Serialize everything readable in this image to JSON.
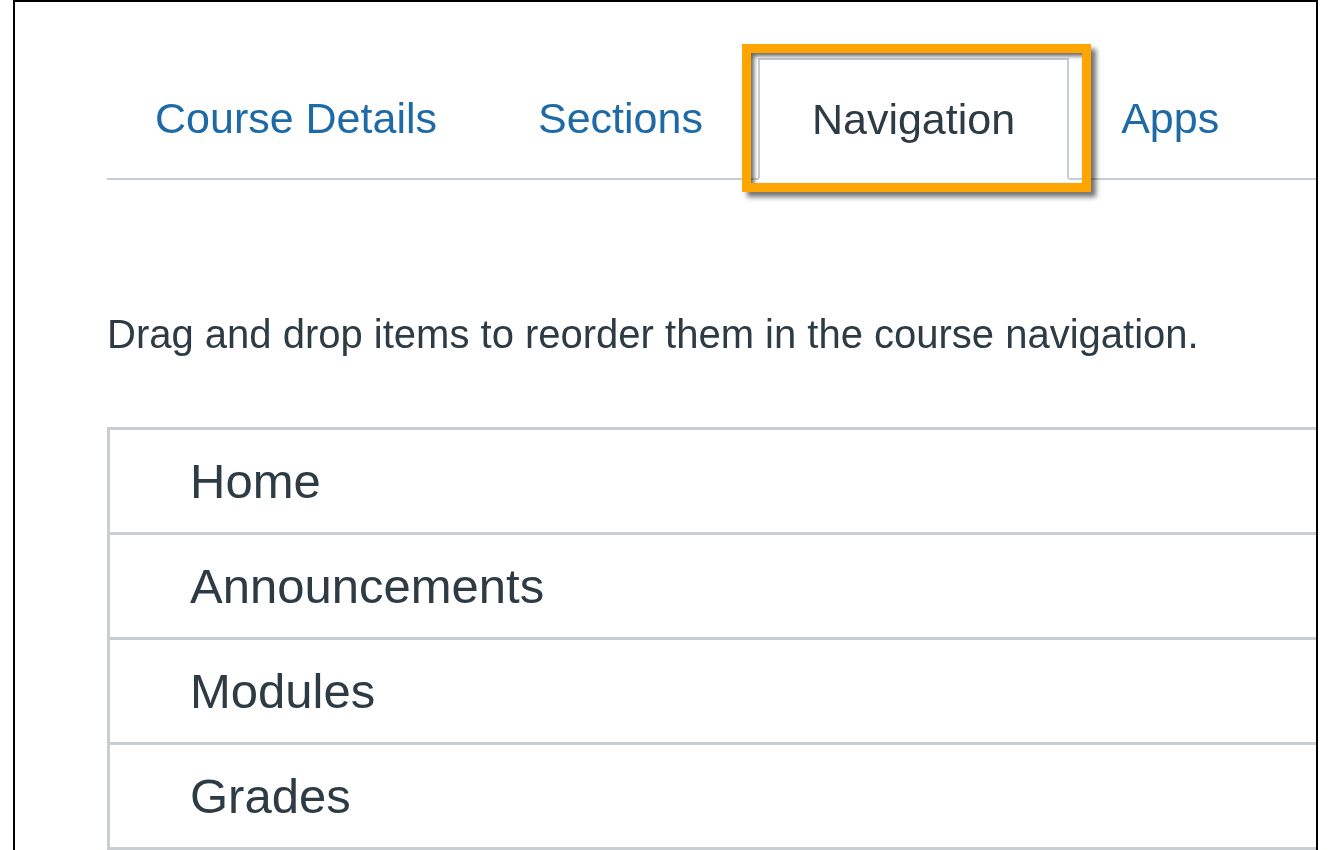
{
  "tabs": [
    {
      "label": "Course Details",
      "selected": false
    },
    {
      "label": "Sections",
      "selected": false
    },
    {
      "label": "Navigation",
      "selected": true
    },
    {
      "label": "Apps",
      "selected": false
    }
  ],
  "instructions": "Drag and drop items to reorder them in the course navigation.",
  "nav_items": [
    {
      "label": "Home"
    },
    {
      "label": "Announcements"
    },
    {
      "label": "Modules"
    },
    {
      "label": "Grades"
    }
  ]
}
